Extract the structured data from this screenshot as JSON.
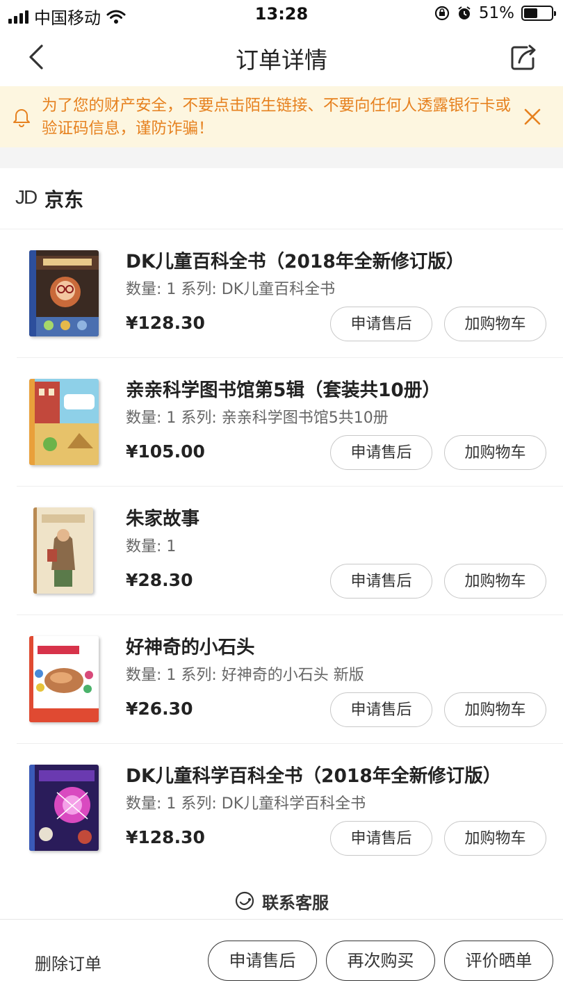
{
  "status_bar": {
    "carrier": "中国移动",
    "time": "13:28",
    "battery_text": "51%",
    "battery_level": 0.51
  },
  "nav": {
    "title": "订单详情"
  },
  "notice": {
    "text": "为了您的财产安全，不要点击陌生链接、不要向任何人透露银行卡或验证码信息，谨防诈骗！",
    "color": "#e6811f"
  },
  "shop": {
    "logo": "JD",
    "name": "京东"
  },
  "products": [
    {
      "title": "DK儿童百科全书（2018年全新修订版）",
      "meta": "数量: 1 系列: DK儿童百科全书",
      "price": "¥128.30",
      "after_sale": "申请售后",
      "add_cart": "加购物车"
    },
    {
      "title": "亲亲科学图书馆第5辑（套装共10册）",
      "meta": "数量: 1 系列: 亲亲科学图书馆5共10册",
      "price": "¥105.00",
      "after_sale": "申请售后",
      "add_cart": "加购物车"
    },
    {
      "title": "朱家故事",
      "meta": "数量: 1",
      "price": "¥28.30",
      "after_sale": "申请售后",
      "add_cart": "加购物车"
    },
    {
      "title": "好神奇的小石头",
      "meta": "数量: 1 系列: 好神奇的小石头 新版",
      "price": "¥26.30",
      "after_sale": "申请售后",
      "add_cart": "加购物车"
    },
    {
      "title": "DK儿童科学百科全书（2018年全新修订版）",
      "meta": "数量: 1 系列: DK儿童科学百科全书",
      "price": "¥128.30",
      "after_sale": "申请售后",
      "add_cart": "加购物车"
    }
  ],
  "contact": {
    "label": "联系客服"
  },
  "bottom": {
    "delete": "删除订单",
    "after_sale": "申请售后",
    "buy_again": "再次购买",
    "review": "评价晒单"
  }
}
